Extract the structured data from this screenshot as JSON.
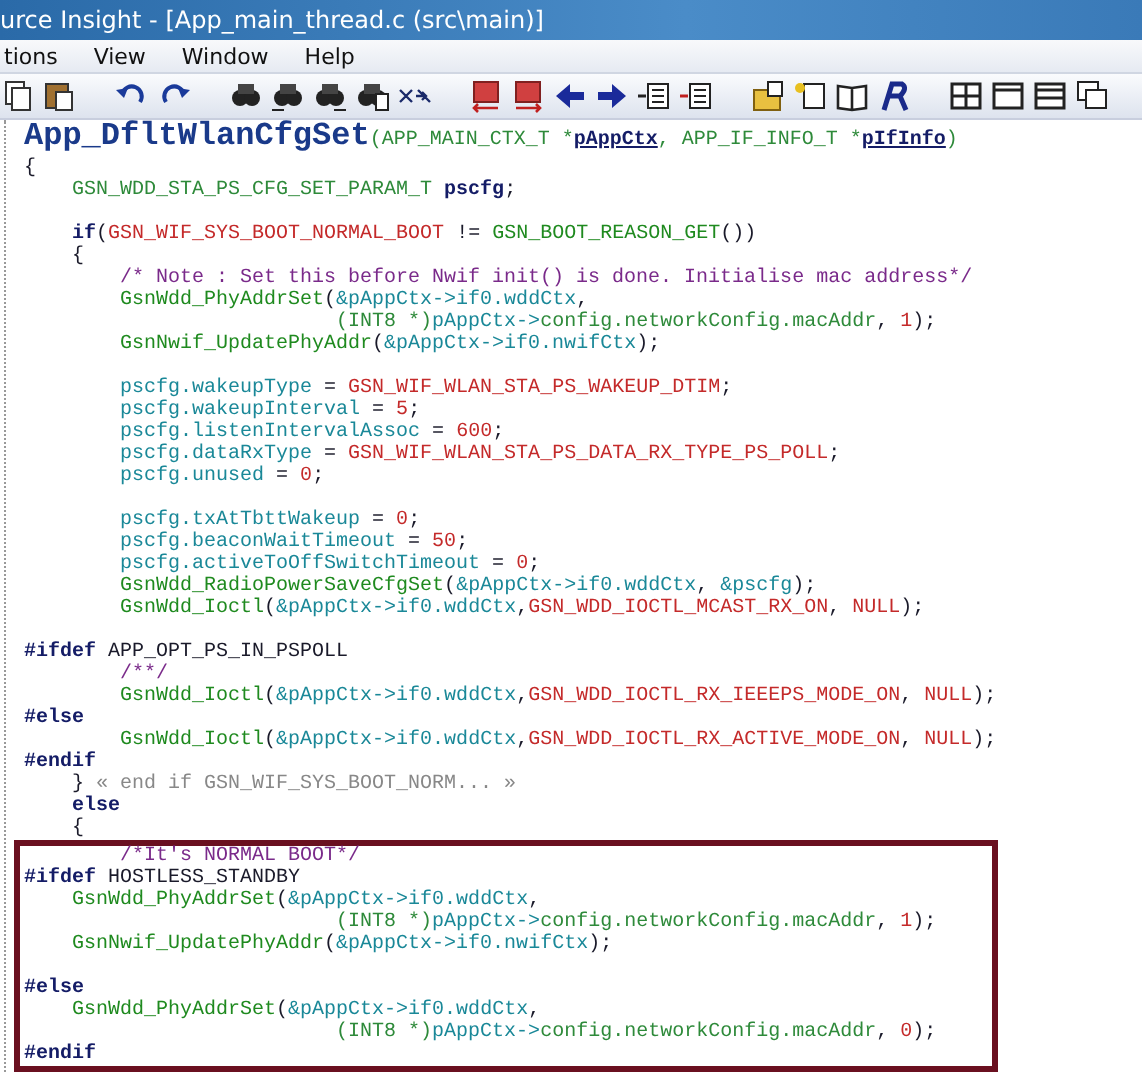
{
  "window": {
    "title": "urce Insight - [App_main_thread.c (src\\main)]"
  },
  "menu": [
    "tions",
    "View",
    "Window",
    "Help"
  ],
  "editor": {
    "signature": [
      {
        "kind": "title",
        "text": "App_DfltWlanCfgSet"
      },
      {
        "kind": "type",
        "text": "(APP_MAIN_CTX_T *"
      },
      {
        "kind": "param",
        "text": "pAppCtx"
      },
      {
        "kind": "type",
        "text": ", APP_IF_INFO_T *"
      },
      {
        "kind": "param",
        "text": "pIfInfo"
      },
      {
        "kind": "type",
        "text": ")"
      }
    ],
    "blocks": [
      {
        "highlighted": false,
        "lines": [
          {
            "kind": "code",
            "segments": [
              {
                "kind": "plain",
                "text": "{"
              }
            ]
          },
          {
            "kind": "code",
            "segments": [
              {
                "kind": "type",
                "text": "    GSN_WDD_STA_PS_CFG_SET_PARAM_T "
              },
              {
                "kind": "kw",
                "text": "pscfg"
              },
              {
                "kind": "plain",
                "text": ";"
              }
            ]
          },
          {
            "kind": "blank"
          },
          {
            "kind": "code",
            "segments": [
              {
                "kind": "kw",
                "text": "    if"
              },
              {
                "kind": "plain",
                "text": "("
              },
              {
                "kind": "const",
                "text": "GSN_WIF_SYS_BOOT_NORMAL_BOOT"
              },
              {
                "kind": "plain",
                "text": " != "
              },
              {
                "kind": "fn",
                "text": "GSN_BOOT_REASON_GET"
              },
              {
                "kind": "plain",
                "text": "())"
              }
            ]
          },
          {
            "kind": "code",
            "segments": [
              {
                "kind": "plain",
                "text": "    {"
              }
            ]
          },
          {
            "kind": "code",
            "segments": [
              {
                "kind": "comment",
                "text": "        /* Note : Set this before Nwif init() is done. Initialise mac address*/"
              }
            ]
          },
          {
            "kind": "code",
            "segments": [
              {
                "kind": "fn",
                "text": "        GsnWdd_PhyAddrSet"
              },
              {
                "kind": "plain",
                "text": "("
              },
              {
                "kind": "var",
                "text": "&pAppCtx->if0.wddCtx"
              },
              {
                "kind": "plain",
                "text": ","
              }
            ]
          },
          {
            "kind": "code",
            "segments": [
              {
                "kind": "type",
                "text": "                          (INT8 *)"
              },
              {
                "kind": "var",
                "text": "pAppCtx->"
              },
              {
                "kind": "type",
                "text": "config.networkConfig.macAddr"
              },
              {
                "kind": "plain",
                "text": ", "
              },
              {
                "kind": "num",
                "text": "1"
              },
              {
                "kind": "plain",
                "text": ");"
              }
            ]
          },
          {
            "kind": "code",
            "segments": [
              {
                "kind": "fn",
                "text": "        GsnNwif_UpdatePhyAddr"
              },
              {
                "kind": "plain",
                "text": "("
              },
              {
                "kind": "var",
                "text": "&pAppCtx->if0.nwifCtx"
              },
              {
                "kind": "plain",
                "text": ");"
              }
            ]
          },
          {
            "kind": "blank"
          },
          {
            "kind": "code",
            "segments": [
              {
                "kind": "var",
                "text": "        pscfg.wakeupType"
              },
              {
                "kind": "plain",
                "text": " = "
              },
              {
                "kind": "const",
                "text": "GSN_WIF_WLAN_STA_PS_WAKEUP_DTIM"
              },
              {
                "kind": "plain",
                "text": ";"
              }
            ]
          },
          {
            "kind": "code",
            "segments": [
              {
                "kind": "var",
                "text": "        pscfg.wakeupInterval"
              },
              {
                "kind": "plain",
                "text": " = "
              },
              {
                "kind": "num",
                "text": "5"
              },
              {
                "kind": "plain",
                "text": ";"
              }
            ]
          },
          {
            "kind": "code",
            "segments": [
              {
                "kind": "var",
                "text": "        pscfg.listenIntervalAssoc"
              },
              {
                "kind": "plain",
                "text": " = "
              },
              {
                "kind": "num",
                "text": "600"
              },
              {
                "kind": "plain",
                "text": ";"
              }
            ]
          },
          {
            "kind": "code",
            "segments": [
              {
                "kind": "var",
                "text": "        pscfg.dataRxType"
              },
              {
                "kind": "plain",
                "text": " = "
              },
              {
                "kind": "const",
                "text": "GSN_WIF_WLAN_STA_PS_DATA_RX_TYPE_PS_POLL"
              },
              {
                "kind": "plain",
                "text": ";"
              }
            ]
          },
          {
            "kind": "code",
            "segments": [
              {
                "kind": "var",
                "text": "        pscfg.unused"
              },
              {
                "kind": "plain",
                "text": " = "
              },
              {
                "kind": "num",
                "text": "0"
              },
              {
                "kind": "plain",
                "text": ";"
              }
            ]
          },
          {
            "kind": "blank"
          },
          {
            "kind": "code",
            "segments": [
              {
                "kind": "var",
                "text": "        pscfg.txAtTbttWakeup"
              },
              {
                "kind": "plain",
                "text": " = "
              },
              {
                "kind": "num",
                "text": "0"
              },
              {
                "kind": "plain",
                "text": ";"
              }
            ]
          },
          {
            "kind": "code",
            "segments": [
              {
                "kind": "var",
                "text": "        pscfg.beaconWaitTimeout"
              },
              {
                "kind": "plain",
                "text": " = "
              },
              {
                "kind": "num",
                "text": "50"
              },
              {
                "kind": "plain",
                "text": ";"
              }
            ]
          },
          {
            "kind": "code",
            "segments": [
              {
                "kind": "var",
                "text": "        pscfg.activeToOffSwitchTimeout"
              },
              {
                "kind": "plain",
                "text": " = "
              },
              {
                "kind": "num",
                "text": "0"
              },
              {
                "kind": "plain",
                "text": ";"
              }
            ]
          },
          {
            "kind": "code",
            "segments": [
              {
                "kind": "fn",
                "text": "        GsnWdd_RadioPowerSaveCfgSet"
              },
              {
                "kind": "plain",
                "text": "("
              },
              {
                "kind": "var",
                "text": "&pAppCtx->if0.wddCtx"
              },
              {
                "kind": "plain",
                "text": ", "
              },
              {
                "kind": "var",
                "text": "&pscfg"
              },
              {
                "kind": "plain",
                "text": ");"
              }
            ]
          },
          {
            "kind": "code",
            "segments": [
              {
                "kind": "fn",
                "text": "        GsnWdd_Ioctl"
              },
              {
                "kind": "plain",
                "text": "("
              },
              {
                "kind": "var",
                "text": "&pAppCtx->if0.wddCtx"
              },
              {
                "kind": "plain",
                "text": ","
              },
              {
                "kind": "const",
                "text": "GSN_WDD_IOCTL_MCAST_RX_ON"
              },
              {
                "kind": "plain",
                "text": ", "
              },
              {
                "kind": "const",
                "text": "NULL"
              },
              {
                "kind": "plain",
                "text": ");"
              }
            ]
          },
          {
            "kind": "blank"
          },
          {
            "kind": "code",
            "segments": [
              {
                "kind": "dir",
                "text": "#ifdef"
              },
              {
                "kind": "plain",
                "text": " APP_OPT_PS_IN_PSPOLL"
              }
            ]
          },
          {
            "kind": "code",
            "segments": [
              {
                "kind": "comment",
                "text": "        /**/"
              }
            ]
          },
          {
            "kind": "code",
            "segments": [
              {
                "kind": "fn",
                "text": "        GsnWdd_Ioctl"
              },
              {
                "kind": "plain",
                "text": "("
              },
              {
                "kind": "var",
                "text": "&pAppCtx->if0.wddCtx"
              },
              {
                "kind": "plain",
                "text": ","
              },
              {
                "kind": "const",
                "text": "GSN_WDD_IOCTL_RX_IEEEPS_MODE_ON"
              },
              {
                "kind": "plain",
                "text": ", "
              },
              {
                "kind": "const",
                "text": "NULL"
              },
              {
                "kind": "plain",
                "text": ");"
              }
            ]
          },
          {
            "kind": "code",
            "segments": [
              {
                "kind": "dir",
                "text": "#else"
              }
            ]
          },
          {
            "kind": "code",
            "segments": [
              {
                "kind": "fn",
                "text": "        GsnWdd_Ioctl"
              },
              {
                "kind": "plain",
                "text": "("
              },
              {
                "kind": "var",
                "text": "&pAppCtx->if0.wddCtx"
              },
              {
                "kind": "plain",
                "text": ","
              },
              {
                "kind": "const",
                "text": "GSN_WDD_IOCTL_RX_ACTIVE_MODE_ON"
              },
              {
                "kind": "plain",
                "text": ", "
              },
              {
                "kind": "const",
                "text": "NULL"
              },
              {
                "kind": "plain",
                "text": ");"
              }
            ]
          },
          {
            "kind": "code",
            "segments": [
              {
                "kind": "dir",
                "text": "#endif"
              }
            ]
          },
          {
            "kind": "code",
            "segments": [
              {
                "kind": "plain",
                "text": "    } "
              },
              {
                "kind": "fold",
                "text": "« end if GSN_WIF_SYS_BOOT_NORM... »"
              }
            ]
          },
          {
            "kind": "code",
            "segments": [
              {
                "kind": "kw",
                "text": "    else"
              }
            ]
          },
          {
            "kind": "code",
            "segments": [
              {
                "kind": "plain",
                "text": "    {"
              }
            ]
          }
        ]
      },
      {
        "highlighted": true,
        "lines": [
          {
            "kind": "code",
            "segments": [
              {
                "kind": "comment",
                "text": "        /*It's NORMAL BOOT*/"
              }
            ]
          },
          {
            "kind": "code",
            "segments": [
              {
                "kind": "dir",
                "text": "#ifdef"
              },
              {
                "kind": "plain",
                "text": " HOSTLESS_STANDBY"
              }
            ]
          },
          {
            "kind": "code",
            "segments": [
              {
                "kind": "fn",
                "text": "    GsnWdd_PhyAddrSet"
              },
              {
                "kind": "plain",
                "text": "("
              },
              {
                "kind": "var",
                "text": "&pAppCtx->if0.wddCtx"
              },
              {
                "kind": "plain",
                "text": ","
              }
            ]
          },
          {
            "kind": "code",
            "segments": [
              {
                "kind": "type",
                "text": "                          (INT8 *)"
              },
              {
                "kind": "var",
                "text": "pAppCtx->"
              },
              {
                "kind": "type",
                "text": "config.networkConfig.macAddr"
              },
              {
                "kind": "plain",
                "text": ", "
              },
              {
                "kind": "num",
                "text": "1"
              },
              {
                "kind": "plain",
                "text": ");"
              }
            ]
          },
          {
            "kind": "code",
            "segments": [
              {
                "kind": "fn",
                "text": "    GsnNwif_UpdatePhyAddr"
              },
              {
                "kind": "plain",
                "text": "("
              },
              {
                "kind": "var",
                "text": "&pAppCtx->if0.nwifCtx"
              },
              {
                "kind": "plain",
                "text": ");"
              }
            ]
          },
          {
            "kind": "blank"
          },
          {
            "kind": "code",
            "segments": [
              {
                "kind": "dir",
                "text": "#else"
              }
            ]
          },
          {
            "kind": "code",
            "segments": [
              {
                "kind": "fn",
                "text": "    GsnWdd_PhyAddrSet"
              },
              {
                "kind": "plain",
                "text": "("
              },
              {
                "kind": "var",
                "text": "&pAppCtx->if0.wddCtx"
              },
              {
                "kind": "plain",
                "text": ","
              }
            ]
          },
          {
            "kind": "code",
            "segments": [
              {
                "kind": "type",
                "text": "                          (INT8 *)"
              },
              {
                "kind": "var",
                "text": "pAppCtx->"
              },
              {
                "kind": "type",
                "text": "config.networkConfig.macAddr"
              },
              {
                "kind": "plain",
                "text": ", "
              },
              {
                "kind": "num",
                "text": "0"
              },
              {
                "kind": "plain",
                "text": ");"
              }
            ]
          },
          {
            "kind": "code",
            "segments": [
              {
                "kind": "dir",
                "text": "#endif"
              }
            ]
          }
        ]
      }
    ]
  }
}
